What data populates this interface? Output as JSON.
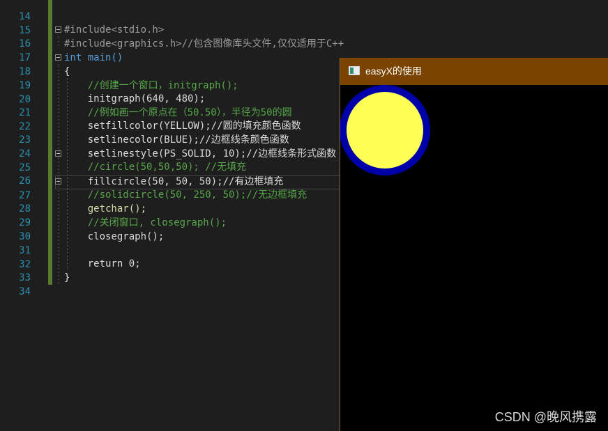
{
  "editor": {
    "lines": [
      {
        "num": "14",
        "code": ""
      },
      {
        "num": "15",
        "code": ""
      },
      {
        "num": "16",
        "code": "#include<stdio.h>"
      },
      {
        "num": "17",
        "code": "#include<graphics.h>//包含图像库头文件,仅仅适用于C++"
      },
      {
        "num": "18",
        "code": "int main()"
      },
      {
        "num": "19",
        "code": "{"
      },
      {
        "num": "20",
        "code": "    //创建一个窗口，initgraph();"
      },
      {
        "num": "21",
        "code": "    initgraph(640, 480);"
      },
      {
        "num": "22",
        "code": "    //例如画一个原点在（50.50），半径为50的圆"
      },
      {
        "num": "23",
        "code": "    setfillcolor(YELLOW);//圆的填充颜色函数"
      },
      {
        "num": "24",
        "code": "    setlinecolor(BLUE);//边框线条颜色函数"
      },
      {
        "num": "25",
        "code": "    setlinestyle(PS_SOLID, 10);//边框线条形式函数"
      },
      {
        "num": "26",
        "code": "    //circle(50,50,50); //无填充"
      },
      {
        "num": "27",
        "code": "    fillcircle(50, 50, 50);//有边框填充"
      },
      {
        "num": "28",
        "code": "    //solidcircle(50, 250, 50);//无边框填充"
      },
      {
        "num": "29",
        "code": "    getchar();"
      },
      {
        "num": "30",
        "code": "    //关闭窗口, closegraph();"
      },
      {
        "num": "31",
        "code": "    closegraph();"
      },
      {
        "num": "32",
        "code": ""
      },
      {
        "num": "33",
        "code": "    return 0;"
      },
      {
        "num": "34",
        "code": "}"
      }
    ]
  },
  "graphics_window": {
    "title": "easyX的使用",
    "circle": {
      "fill": "#ffff55",
      "stroke": "#0000aa"
    }
  },
  "watermark": "CSDN @晚风携露",
  "colors": {
    "editor_bg": "#1e1e1e",
    "line_number": "#2b91af",
    "comment": "#57a64a",
    "keyword": "#569cd6",
    "titlebar": "#7a4300"
  }
}
